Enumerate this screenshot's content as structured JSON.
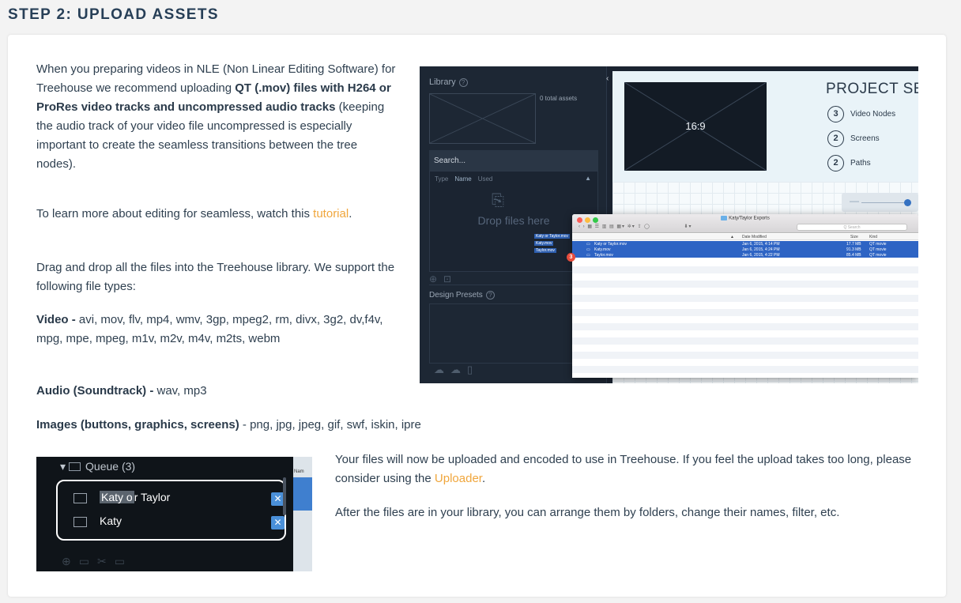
{
  "step_title": "STEP 2: UPLOAD ASSETS",
  "intro": {
    "p1_before": "When you preparing videos in NLE (Non Linear Editing Software) for Treehouse we recommend uploading ",
    "p1_bold": "QT (.mov) files with H264 or ProRes video tracks and uncompressed audio tracks",
    "p1_after": " (keeping the audio track of your video file uncompressed is especially important to create the seamless transitions between the tree nodes).",
    "p2_before": "To learn more about editing for seamless, watch this ",
    "p2_link": "tutorial",
    "p2_after": ".",
    "p3": "Drag and drop all the files into the Treehouse library. We support the following file types:",
    "video_label": "Video  - ",
    "video_types": "avi, mov, flv, mp4, wmv, 3gp, mpeg2, rm, divx, 3g2, dv,f4v, mpg, mpe, mpeg, m1v, m2v, m4v, m2ts, webm",
    "audio_label": "Audio (Soundtrack)  - ",
    "audio_types": "wav, mp3",
    "images_label": "Images (buttons, graphics, screens)",
    "images_types": " - png, jpg, jpeg, gif, swf, iskin, ipre"
  },
  "outro": {
    "p1_before": "Your files will now be uploaded and encoded to use in Treehouse. If you feel the upload takes too long, please consider using the ",
    "p1_link": "Uploader",
    "p1_after": ".",
    "p2": "After the files are in your library, you can arrange them by folders, change their names, filter, etc."
  },
  "editor": {
    "library_title": "Library",
    "total_assets": "0 total assets",
    "search_placeholder": "Search...",
    "col_type": "Type",
    "col_name": "Name",
    "col_used": "Used",
    "drop_text": "Drop files here",
    "design_presets": "Design Presets",
    "aspect_ratio": "16:9",
    "project_title": "PROJECT SET",
    "stats": [
      {
        "count": "3",
        "label": "Video Nodes"
      },
      {
        "count": "2",
        "label": "Screens"
      },
      {
        "count": "2",
        "label": "Paths"
      }
    ],
    "drag_badge": "3",
    "drag_labels": [
      "Katy or Taylor.mov",
      "Katy.mov",
      "Taylor.mov"
    ]
  },
  "finder": {
    "title": "Katy/Taylor Exports",
    "search_placeholder": "Q Search",
    "headers": {
      "date": "Date Modified",
      "size": "Size",
      "kind": "Kind"
    },
    "rows": [
      {
        "name": "Katy or Taylor.mov",
        "date": "Jan 6, 2015, 4:14 PM",
        "size": "17.7 MB",
        "kind": "QT movie"
      },
      {
        "name": "Katy.mov",
        "date": "Jan 6, 2015, 4:24 PM",
        "size": "91.3 MB",
        "kind": "QT movie"
      },
      {
        "name": "Taylor.mov",
        "date": "Jan 6, 2015, 4:22 PM",
        "size": "85.4 MB",
        "kind": "QT movie"
      }
    ]
  },
  "queue": {
    "title": "Queue (3)",
    "items": [
      {
        "label_sel": "Katy o",
        "label_rest": "r Taylor"
      },
      {
        "label_sel": "",
        "label_rest": "Katy"
      }
    ],
    "side_label": "Nam"
  },
  "colors": {
    "accent_link": "#f0a63c",
    "title": "#273f57",
    "finder_selection": "#2e64c4"
  }
}
